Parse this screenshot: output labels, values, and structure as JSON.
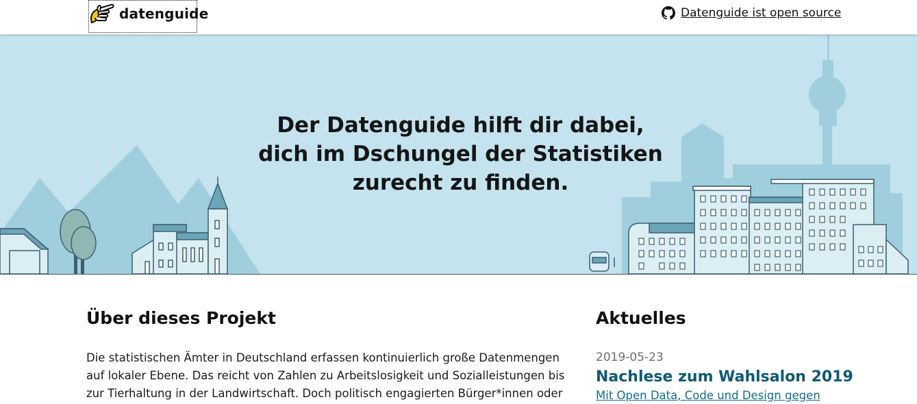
{
  "header": {
    "logo_text": "datenguide",
    "github_link": "Datenguide ist open source"
  },
  "hero": {
    "title": "Der Datenguide hilft dir dabei, dich im Dschungel der Statistiken zurecht zu finden."
  },
  "about": {
    "heading": "Über dieses Projekt",
    "text": "Die statistischen Ämter in Deutschland erfassen kontinuierlich große Datenmengen auf lokaler Ebene. Das reicht von Zahlen zu Arbeitslosigkeit und Sozialleistungen bis zur Tierhaltung in der Landwirtschaft. Doch politisch engagierten Bürger*innen oder"
  },
  "news": {
    "heading": "Aktuelles",
    "items": [
      {
        "date": "2019-05-23",
        "title": "Nachlese zum Wahlsalon 2019",
        "teaser": "Mit Open Data, Code und Design gegen"
      }
    ]
  },
  "colors": {
    "hero_background": "#c4e3ef",
    "building_fill": "#dbeef4",
    "building_stroke": "#3f5f6e",
    "skyline_shade": "#9fcfdd",
    "news_title": "#0f5a73",
    "news_link": "#0f6e88"
  },
  "icons": {
    "logo": "pointing-hand-icon",
    "github": "github-icon"
  }
}
